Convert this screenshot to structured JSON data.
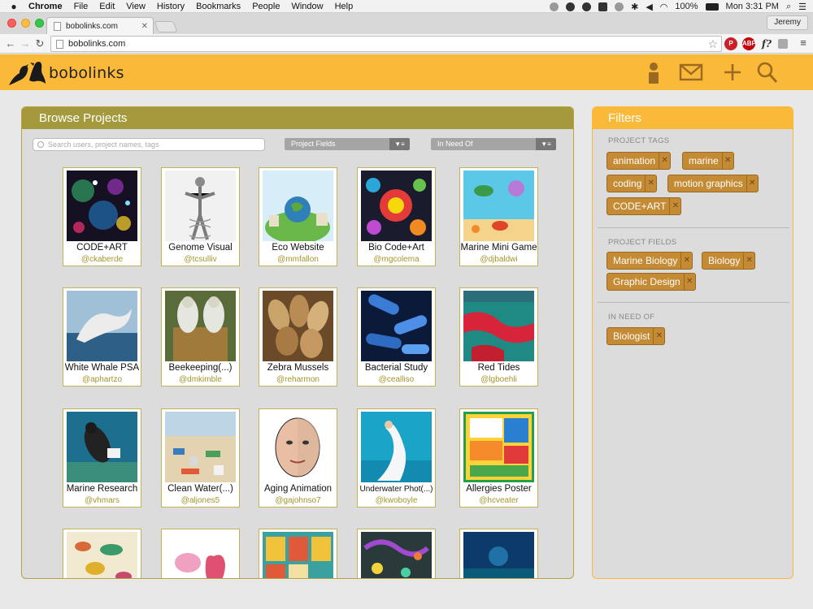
{
  "os_menubar": {
    "app": "Chrome",
    "items": [
      "File",
      "Edit",
      "View",
      "History",
      "Bookmarks",
      "People",
      "Window",
      "Help"
    ],
    "battery": "100%",
    "clock": "Mon 3:31 PM"
  },
  "browser": {
    "tab_title": "bobolinks.com",
    "profile": "Jeremy",
    "url": "bobolinks.com"
  },
  "site": {
    "logo_text": "bobolinks",
    "icons": [
      "user-icon",
      "mail-icon",
      "plus-icon",
      "search-icon"
    ],
    "accent_color": "#fbb939",
    "panel_color": "#a49a3d"
  },
  "browse": {
    "title": "Browse Projects",
    "search_placeholder": "Search users, project names, tags",
    "dropdowns": [
      "Project Fields",
      "In Need Of"
    ],
    "projects": [
      {
        "title": "CODE+ART",
        "user": "@ckaberde"
      },
      {
        "title": "Genome Visual",
        "user": "@tcsulliv"
      },
      {
        "title": "Eco Website",
        "user": "@mmfallon"
      },
      {
        "title": "Bio Code+Art",
        "user": "@mgcolema"
      },
      {
        "title": "Marine Mini Game",
        "user": "@djbaldwi"
      },
      {
        "title": "White Whale PSA",
        "user": "@aphartzo"
      },
      {
        "title": "Beekeeping(...)",
        "user": "@dmkimble"
      },
      {
        "title": "Zebra Mussels",
        "user": "@reharmon"
      },
      {
        "title": "Bacterial Study",
        "user": "@cealliso"
      },
      {
        "title": "Red Tides",
        "user": "@lgboehli"
      },
      {
        "title": "Marine Research",
        "user": "@vhmars"
      },
      {
        "title": "Clean Water(...)",
        "user": "@aljones5"
      },
      {
        "title": "Aging Animation",
        "user": "@gajohnso7"
      },
      {
        "title": "Underwater Phot(...)",
        "user": "@kwoboyle"
      },
      {
        "title": "Allergies Poster",
        "user": "@hcveater"
      },
      {
        "title": "",
        "user": ""
      },
      {
        "title": "",
        "user": ""
      },
      {
        "title": "",
        "user": ""
      },
      {
        "title": "",
        "user": ""
      },
      {
        "title": "",
        "user": ""
      }
    ]
  },
  "filters": {
    "title": "Filters",
    "sections": [
      {
        "heading": "PROJECT TAGS",
        "chips": [
          "animation",
          "marine",
          "coding",
          "motion graphics",
          "CODE+ART"
        ]
      },
      {
        "heading": "PROJECT FIELDS",
        "chips": [
          "Marine Biology",
          "Biology",
          "Graphic Design"
        ]
      },
      {
        "heading": "IN NEED OF",
        "chips": [
          "Biologist"
        ]
      }
    ]
  }
}
